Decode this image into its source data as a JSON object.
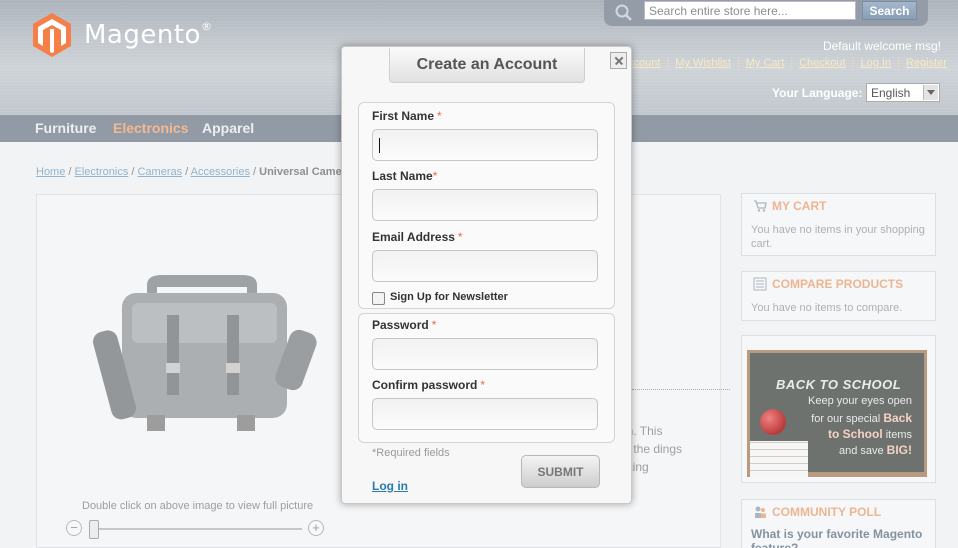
{
  "header": {
    "logo_text": "Magento",
    "logo_mark": "®",
    "search": {
      "placeholder": "Search entire store here...",
      "button_label": "Search"
    },
    "welcome": "Default welcome msg!",
    "top_links": [
      "ccount",
      "My Wishlist",
      "My Cart",
      "Checkout",
      "Log In",
      "Register"
    ],
    "language_label": "Your Language:",
    "language_value": "English"
  },
  "nav": {
    "items": [
      "Furniture",
      "Electronics",
      "Apparel"
    ],
    "active": "Electronics"
  },
  "breadcrumb": {
    "links": [
      "Home",
      "Electronics",
      "Cameras",
      "Accessories"
    ],
    "current": "Universal Came"
  },
  "product": {
    "zoom_hint": "Double click on above image to view full picture",
    "desc_fragments": [
      "e",
      "on. This",
      "m the dings",
      "oking"
    ]
  },
  "sidebar": {
    "cart": {
      "title": "MY CART",
      "text": "You have no items in your shopping cart."
    },
    "compare": {
      "title": "COMPARE PRODUCTS",
      "text": "You have no items to compare."
    },
    "promo": {
      "title": "BACK TO SCHOOL",
      "line1": "Keep your eyes open",
      "line2a": "for our special ",
      "line2b": "Back",
      "line3a": "to School",
      "line3b": " items",
      "line4a": "and save ",
      "line4b": "BIG!"
    },
    "poll": {
      "title": "COMMUNITY POLL",
      "question": "What is your favorite Magento feature?"
    }
  },
  "modal": {
    "title": "Create an Account",
    "fields": {
      "first_name": "First Name",
      "last_name": "Last Name",
      "email": "Email Address",
      "newsletter": "Sign Up for Newsletter",
      "password": "Password",
      "confirm": "Confirm password"
    },
    "required_mark": "*",
    "required_note": "*Required fields",
    "login_link": "Log in",
    "submit": "SUBMIT"
  },
  "colors": {
    "accent": "#e9a57a",
    "link": "#2a7cb0",
    "nav_bg": "#7b8592"
  }
}
